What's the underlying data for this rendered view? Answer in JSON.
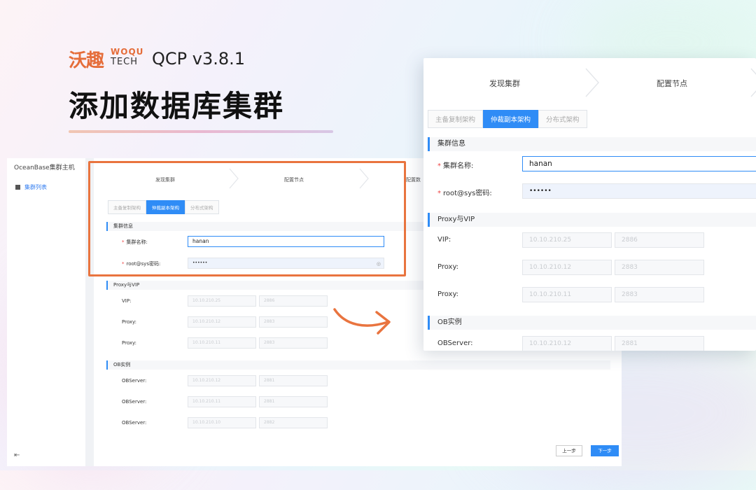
{
  "brand": {
    "logo_cn": "沃趣",
    "logo_woqu": "WOQU",
    "logo_tech": "TECH",
    "version": "QCP v3.8.1",
    "headline": "添加数据库集群"
  },
  "colors": {
    "accent": "#2f8cf6",
    "highlight": "#e9743f",
    "brand": "#e56d3a"
  },
  "app": {
    "title": "OceanBase集群主机",
    "nav_item": "集群列表",
    "collapse_icon": "collapse-icon"
  },
  "steps": [
    "发现集群",
    "配置节点",
    "配置数"
  ],
  "tabs": [
    "主备复制架构",
    "仲裁副本架构",
    "分布式架构"
  ],
  "cluster_section": {
    "title": "集群信息",
    "name_label": "集群名称:",
    "name_value": "hanan",
    "password_label": "root@sys密码:",
    "password_value": "••••••"
  },
  "proxy_section": {
    "title": "Proxy与VIP",
    "rows": [
      {
        "label": "VIP:",
        "ip": "10.10.210.25",
        "port": "2886"
      },
      {
        "label": "Proxy:",
        "ip": "10.10.210.12",
        "port": "2883"
      },
      {
        "label": "Proxy:",
        "ip": "10.10.210.11",
        "port": "2883"
      }
    ]
  },
  "ob_section": {
    "title": "OB实例",
    "rows": [
      {
        "label": "OBServer:",
        "ip": "10.10.210.12",
        "port": "2881"
      },
      {
        "label": "OBServer:",
        "ip": "10.10.210.11",
        "port": "2881"
      },
      {
        "label": "OBServer:",
        "ip": "10.10.210.10",
        "port": "2882"
      }
    ]
  },
  "buttons": {
    "prev": "上一步",
    "next": "下一步"
  }
}
